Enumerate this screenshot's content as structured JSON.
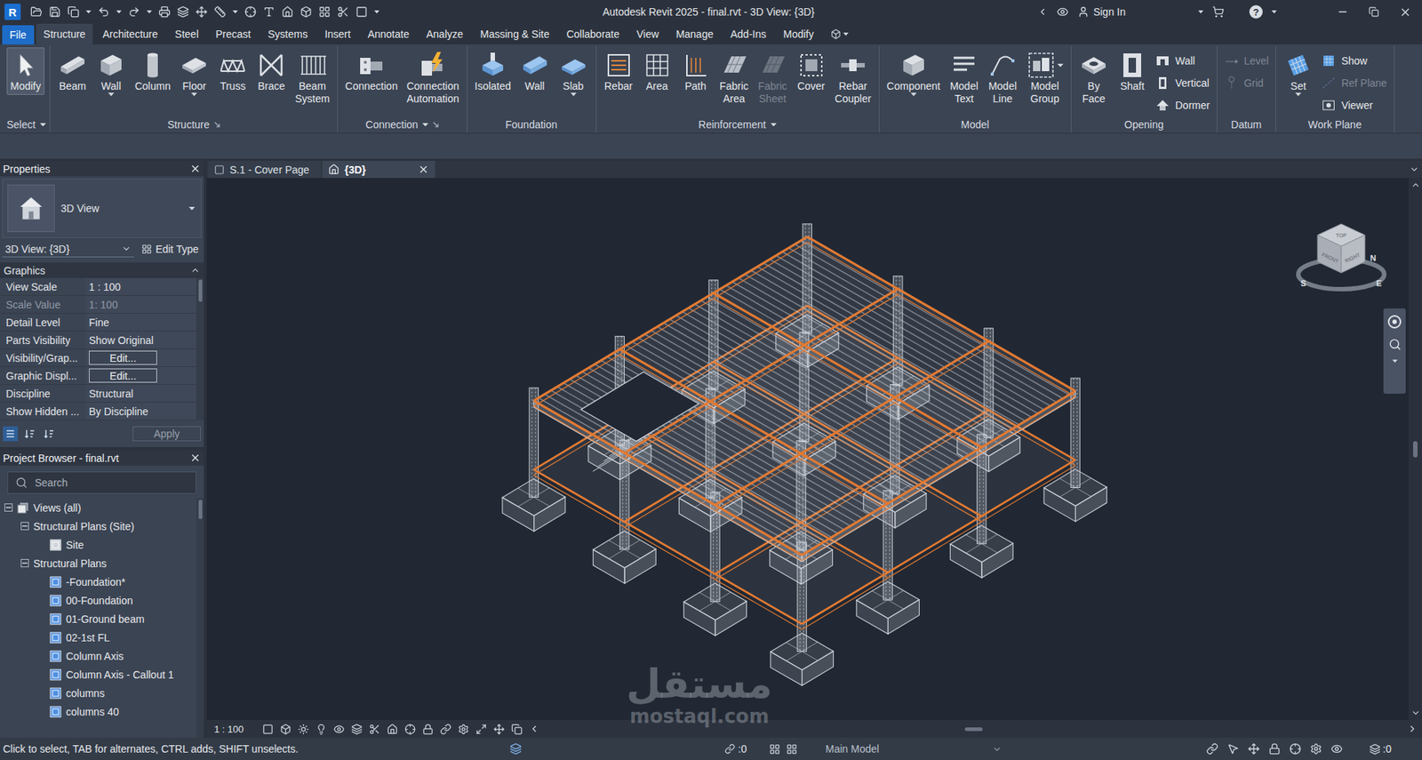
{
  "window": {
    "logo": "R",
    "title": "Autodesk Revit 2025 - final.rvt - 3D View: {3D}",
    "sign_in": "Sign In",
    "help": "?"
  },
  "ribbon_tabs": [
    {
      "label": "File",
      "kind": "file",
      "selected": false
    },
    {
      "label": "Structure",
      "kind": "tab",
      "selected": true
    },
    {
      "label": "Architecture",
      "kind": "tab",
      "selected": false
    },
    {
      "label": "Steel",
      "kind": "tab",
      "selected": false
    },
    {
      "label": "Precast",
      "kind": "tab",
      "selected": false
    },
    {
      "label": "Systems",
      "kind": "tab",
      "selected": false
    },
    {
      "label": "Insert",
      "kind": "tab",
      "selected": false
    },
    {
      "label": "Annotate",
      "kind": "tab",
      "selected": false
    },
    {
      "label": "Analyze",
      "kind": "tab",
      "selected": false
    },
    {
      "label": "Massing & Site",
      "kind": "tab",
      "selected": false
    },
    {
      "label": "Collaborate",
      "kind": "tab",
      "selected": false
    },
    {
      "label": "View",
      "kind": "tab",
      "selected": false
    },
    {
      "label": "Manage",
      "kind": "tab",
      "selected": false
    },
    {
      "label": "Add-Ins",
      "kind": "tab",
      "selected": false
    },
    {
      "label": "Modify",
      "kind": "tab",
      "selected": false
    }
  ],
  "ribbon_groups": [
    {
      "title": "Select",
      "dropdown": true,
      "launcher": false,
      "tools": [
        {
          "kind": "large",
          "lines": [
            "Modify"
          ],
          "active": true,
          "disabled": false,
          "dropdown": "none"
        }
      ]
    },
    {
      "title": "Structure",
      "dropdown": false,
      "launcher": true,
      "tools": [
        {
          "kind": "large",
          "lines": [
            "Beam"
          ],
          "active": false,
          "disabled": false,
          "dropdown": "none"
        },
        {
          "kind": "large",
          "lines": [
            "Wall"
          ],
          "active": false,
          "disabled": false,
          "dropdown": "below"
        },
        {
          "kind": "large",
          "lines": [
            "Column"
          ],
          "active": false,
          "disabled": false,
          "dropdown": "none"
        },
        {
          "kind": "large",
          "lines": [
            "Floor"
          ],
          "active": false,
          "disabled": false,
          "dropdown": "below"
        },
        {
          "kind": "large",
          "lines": [
            "Truss"
          ],
          "active": false,
          "disabled": false,
          "dropdown": "none"
        },
        {
          "kind": "large",
          "lines": [
            "Brace"
          ],
          "active": false,
          "disabled": false,
          "dropdown": "none"
        },
        {
          "kind": "large",
          "lines": [
            "Beam",
            "System"
          ],
          "active": false,
          "disabled": false,
          "dropdown": "none"
        }
      ]
    },
    {
      "title": "Connection",
      "dropdown": true,
      "launcher": true,
      "tools": [
        {
          "kind": "large",
          "lines": [
            "Connection"
          ],
          "active": false,
          "disabled": false,
          "dropdown": "none"
        },
        {
          "kind": "large",
          "lines": [
            "Connection",
            "Automation"
          ],
          "active": false,
          "disabled": false,
          "dropdown": "none"
        }
      ]
    },
    {
      "title": "Foundation",
      "dropdown": false,
      "launcher": false,
      "tools": [
        {
          "kind": "large",
          "lines": [
            "Isolated"
          ],
          "active": false,
          "disabled": false,
          "dropdown": "none"
        },
        {
          "kind": "large",
          "lines": [
            "Wall"
          ],
          "active": false,
          "disabled": false,
          "dropdown": "none"
        },
        {
          "kind": "large",
          "lines": [
            "Slab"
          ],
          "active": false,
          "disabled": false,
          "dropdown": "below"
        }
      ]
    },
    {
      "title": "Reinforcement",
      "dropdown": true,
      "launcher": false,
      "tools": [
        {
          "kind": "large",
          "lines": [
            "Rebar"
          ],
          "active": false,
          "disabled": false,
          "dropdown": "none"
        },
        {
          "kind": "large",
          "lines": [
            "Area"
          ],
          "active": false,
          "disabled": false,
          "dropdown": "none"
        },
        {
          "kind": "large",
          "lines": [
            "Path"
          ],
          "active": false,
          "disabled": false,
          "dropdown": "none"
        },
        {
          "kind": "large",
          "lines": [
            "Fabric",
            "Area"
          ],
          "active": false,
          "disabled": false,
          "dropdown": "none"
        },
        {
          "kind": "large",
          "lines": [
            "Fabric",
            "Sheet"
          ],
          "active": false,
          "disabled": true,
          "dropdown": "none"
        },
        {
          "kind": "large",
          "lines": [
            "Cover"
          ],
          "active": false,
          "disabled": false,
          "dropdown": "none"
        },
        {
          "kind": "large",
          "lines": [
            "Rebar",
            "Coupler"
          ],
          "active": false,
          "disabled": false,
          "dropdown": "none"
        }
      ]
    },
    {
      "title": "Model",
      "dropdown": false,
      "launcher": false,
      "tools": [
        {
          "kind": "large",
          "lines": [
            "Component"
          ],
          "active": false,
          "disabled": false,
          "dropdown": "below"
        },
        {
          "kind": "large",
          "lines": [
            "Model",
            "Text"
          ],
          "active": false,
          "disabled": false,
          "dropdown": "none"
        },
        {
          "kind": "large",
          "lines": [
            "Model",
            "Line"
          ],
          "active": false,
          "disabled": false,
          "dropdown": "none"
        },
        {
          "kind": "large",
          "lines": [
            "Model",
            "Group"
          ],
          "active": false,
          "disabled": false,
          "dropdown": "side"
        }
      ]
    },
    {
      "title": "Opening",
      "dropdown": false,
      "launcher": false,
      "tools": [
        {
          "kind": "large",
          "lines": [
            "By",
            "Face"
          ],
          "active": false,
          "disabled": false,
          "dropdown": "none"
        },
        {
          "kind": "large",
          "lines": [
            "Shaft"
          ],
          "active": false,
          "disabled": false,
          "dropdown": "none"
        },
        {
          "kind": "small",
          "lines": [
            "Wall"
          ],
          "active": false,
          "disabled": false,
          "dropdown": "none"
        },
        {
          "kind": "small",
          "lines": [
            "Vertical"
          ],
          "active": false,
          "disabled": false,
          "dropdown": "none"
        },
        {
          "kind": "small",
          "lines": [
            "Dormer"
          ],
          "active": false,
          "disabled": false,
          "dropdown": "none"
        }
      ]
    },
    {
      "title": "Datum",
      "dropdown": false,
      "launcher": false,
      "tools": [
        {
          "kind": "small",
          "lines": [
            "Level"
          ],
          "active": false,
          "disabled": true,
          "dropdown": "none"
        },
        {
          "kind": "small",
          "lines": [
            "Grid"
          ],
          "active": false,
          "disabled": true,
          "dropdown": "none"
        }
      ]
    },
    {
      "title": "Work Plane",
      "dropdown": false,
      "launcher": false,
      "tools": [
        {
          "kind": "large",
          "lines": [
            "Set"
          ],
          "active": false,
          "disabled": false,
          "dropdown": "below"
        },
        {
          "kind": "small",
          "lines": [
            "Show"
          ],
          "active": false,
          "disabled": false,
          "dropdown": "none"
        },
        {
          "kind": "small",
          "lines": [
            "Ref Plane"
          ],
          "active": false,
          "disabled": true,
          "dropdown": "none"
        },
        {
          "kind": "small",
          "lines": [
            "Viewer"
          ],
          "active": false,
          "disabled": false,
          "dropdown": "none"
        }
      ]
    }
  ],
  "properties": {
    "title": "Properties",
    "type_name": "3D View",
    "instance": "3D View: {3D}",
    "edit_type": "Edit Type",
    "section": "Graphics",
    "rows": [
      {
        "name": "View Scale",
        "value": "1 : 100",
        "kind": "text",
        "disabled": false
      },
      {
        "name": "Scale Value",
        "value": "1: 100",
        "kind": "text",
        "disabled": true
      },
      {
        "name": "Detail Level",
        "value": "Fine",
        "kind": "text",
        "disabled": false
      },
      {
        "name": "Parts Visibility",
        "value": "Show Original",
        "kind": "text",
        "disabled": false
      },
      {
        "name": "Visibility/Grap...",
        "value": "Edit...",
        "kind": "button",
        "disabled": false
      },
      {
        "name": "Graphic Displ...",
        "value": "Edit...",
        "kind": "button",
        "disabled": false
      },
      {
        "name": "Discipline",
        "value": "Structural",
        "kind": "text",
        "disabled": false
      },
      {
        "name": "Show Hidden ...",
        "value": "By Discipline",
        "kind": "text",
        "disabled": false
      }
    ],
    "apply": "Apply",
    "apply_disabled": true
  },
  "project_browser": {
    "title": "Project Browser - final.rvt",
    "search_placeholder": "Search",
    "items": [
      {
        "label": "Views (all)",
        "level": 0,
        "kind": "root",
        "expanded": true
      },
      {
        "label": "Structural Plans (Site)",
        "level": 1,
        "kind": "group",
        "expanded": true
      },
      {
        "label": "Site",
        "level": 2,
        "kind": "view",
        "expanded": false
      },
      {
        "label": "Structural Plans",
        "level": 1,
        "kind": "group",
        "expanded": true
      },
      {
        "label": "-Foundation*",
        "level": 2,
        "kind": "view",
        "expanded": false
      },
      {
        "label": "00-Foundation",
        "level": 2,
        "kind": "view",
        "expanded": false
      },
      {
        "label": "01-Ground beam",
        "level": 2,
        "kind": "view",
        "expanded": false
      },
      {
        "label": "02-1st FL",
        "level": 2,
        "kind": "view",
        "expanded": false
      },
      {
        "label": "Column Axis",
        "level": 2,
        "kind": "view",
        "expanded": false
      },
      {
        "label": "Column Axis - Callout 1",
        "level": 2,
        "kind": "view",
        "expanded": false
      },
      {
        "label": "columns",
        "level": 2,
        "kind": "view",
        "expanded": false
      },
      {
        "label": "columns 40",
        "level": 2,
        "kind": "view",
        "expanded": false
      }
    ]
  },
  "view_tabs": [
    {
      "label": "S.1 - Cover Page",
      "selected": false,
      "closable": false
    },
    {
      "label": "{3D}",
      "selected": true,
      "closable": true
    }
  ],
  "view_cube": {
    "faces": [
      "TOP",
      "FRONT",
      "RIGHT"
    ],
    "compass": [
      "N",
      "E",
      "S"
    ]
  },
  "view_bar": {
    "scale": "1 : 100"
  },
  "status_bar": {
    "hint": "Click to select, TAB for alternates, CTRL adds, SHIFT unselects.",
    "worksets": ":0",
    "model": "Main Model",
    "filter": ":0"
  },
  "watermark": {
    "arabic": "مستقل",
    "latin": "mostaql.com"
  }
}
